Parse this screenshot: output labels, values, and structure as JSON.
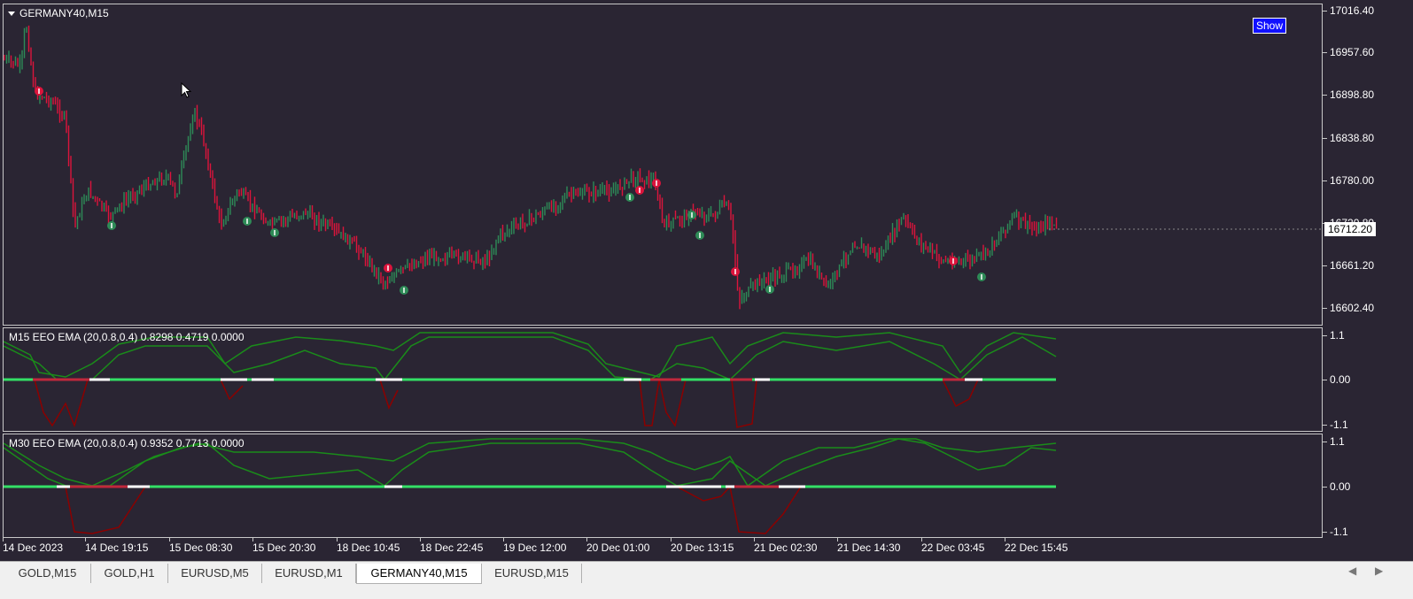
{
  "main_chart": {
    "title": "GERMANY40,M15",
    "show_label": "Show",
    "y_labels": [
      "17016.40",
      "16957.60",
      "16898.80",
      "16838.80",
      "16780.00",
      "16720.80",
      "16661.20",
      "16602.40"
    ],
    "current_price": "16712.20",
    "up_color": "#2e8b57",
    "down_color": "#dc143c"
  },
  "indicator1": {
    "title": "M15 EEO EMA (20,0.8,0.4) 0.8298 0.4719 0.0000",
    "y_labels": [
      "1.1",
      "0.00",
      "-1.1"
    ]
  },
  "indicator2": {
    "title": "M30 EEO EMA (20,0.8,0.4) 0.9352 0.7713 0.0000",
    "y_labels": [
      "1.1",
      "0.00",
      "-1.1"
    ]
  },
  "x_axis": {
    "labels": [
      "14 Dec 2023",
      "14 Dec 19:15",
      "15 Dec 08:30",
      "15 Dec 20:30",
      "18 Dec 10:45",
      "18 Dec 22:45",
      "19 Dec 12:00",
      "20 Dec 01:00",
      "20 Dec 13:15",
      "21 Dec 02:30",
      "21 Dec 14:30",
      "22 Dec 03:45",
      "22 Dec 15:45"
    ]
  },
  "tabs": [
    {
      "label": "GOLD,M15",
      "active": false
    },
    {
      "label": "GOLD,H1",
      "active": false
    },
    {
      "label": "EURUSD,M5",
      "active": false
    },
    {
      "label": "EURUSD,M1",
      "active": false
    },
    {
      "label": "GERMANY40,M15",
      "active": true
    },
    {
      "label": "EURUSD,M15",
      "active": false
    }
  ],
  "colors": {
    "background": "#2a2533",
    "zero_line": "#33e066",
    "oscillator_green": "#1a8c1a",
    "oscillator_dark_red": "#8b0000",
    "signal_red": "#dc143c",
    "signal_green": "#2e8b57",
    "show_button": "#1010ff"
  }
}
